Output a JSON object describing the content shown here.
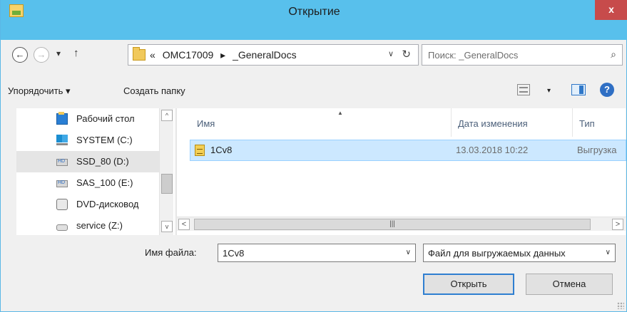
{
  "window": {
    "title": "Открытие",
    "close_label": "x"
  },
  "nav": {
    "back_glyph": "←",
    "forward_glyph": "→",
    "history_glyph": "▾",
    "up_glyph": "↑"
  },
  "address": {
    "prefix": "«",
    "segments": [
      "OMC17009",
      "_GeneralDocs"
    ],
    "separator": "▸",
    "dropdown_glyph": "∨",
    "refresh_glyph": "↻"
  },
  "search": {
    "placeholder": "Поиск: _GeneralDocs",
    "icon_glyph": "⌕"
  },
  "toolbar": {
    "organize_label": "Упорядочить ▾",
    "new_folder_label": "Создать папку",
    "view_dropdown_glyph": "▾",
    "help_glyph": "?"
  },
  "navpane": {
    "items": [
      {
        "label": "Рабочий стол",
        "icon": "desktop-icon",
        "selected": false
      },
      {
        "label": "SYSTEM (C:)",
        "icon": "system-drive-icon",
        "selected": false
      },
      {
        "label": "SSD_80 (D:)",
        "icon": "hdd-icon",
        "selected": true
      },
      {
        "label": "SAS_100 (E:)",
        "icon": "hdd-icon",
        "selected": false
      },
      {
        "label": "DVD-дисковод",
        "icon": "dvd-icon",
        "selected": false
      },
      {
        "label": "service (Z:)",
        "icon": "network-drive-icon",
        "selected": false
      }
    ],
    "scroll_up_glyph": "^",
    "scroll_down_glyph": "v"
  },
  "filelist": {
    "columns": [
      "Имя",
      "Дата изменения",
      "Тип"
    ],
    "sort_glyph": "▲",
    "rows": [
      {
        "name": "1Cv8",
        "date": "13.03.2018 10:22",
        "type": "Выгрузка"
      }
    ],
    "hscroll": {
      "left_glyph": "<",
      "right_glyph": ">",
      "thumb_glyph": "|||"
    }
  },
  "bottom": {
    "filename_label": "Имя файла:",
    "filename_value": "1Cv8",
    "filename_dropdown_glyph": "∨",
    "filter_value": "Файл для выгружаемых данных",
    "filter_dropdown_glyph": "∨",
    "open_label": "Открыть",
    "cancel_label": "Отмена"
  }
}
